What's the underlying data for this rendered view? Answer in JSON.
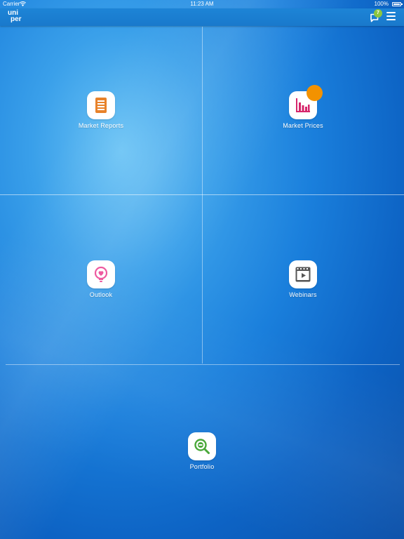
{
  "status_bar": {
    "carrier": "Carrier",
    "time": "11:23 AM",
    "battery": "100%"
  },
  "nav": {
    "logo_line1": "uni",
    "logo_line2": "per",
    "notification_count": "7"
  },
  "tiles": {
    "market_reports": {
      "label": "Market Reports",
      "icon": "document-icon",
      "color": "#e8822a"
    },
    "market_prices": {
      "label": "Market Prices",
      "icon": "bar-chart-icon",
      "color": "#d6266b"
    },
    "outlook": {
      "label": "Outlook",
      "icon": "lightbulb-icon",
      "color": "#ee5aa0"
    },
    "webinars": {
      "label": "Webinars",
      "icon": "video-play-icon",
      "color": "#555555"
    },
    "portfolio": {
      "label": "Portfolio",
      "icon": "magnifier-icon",
      "color": "#4aa83a"
    }
  },
  "colors": {
    "badge_green": "#8cc63f",
    "badge_orange": "#f39200",
    "background_blue": "#1a7fdc"
  }
}
